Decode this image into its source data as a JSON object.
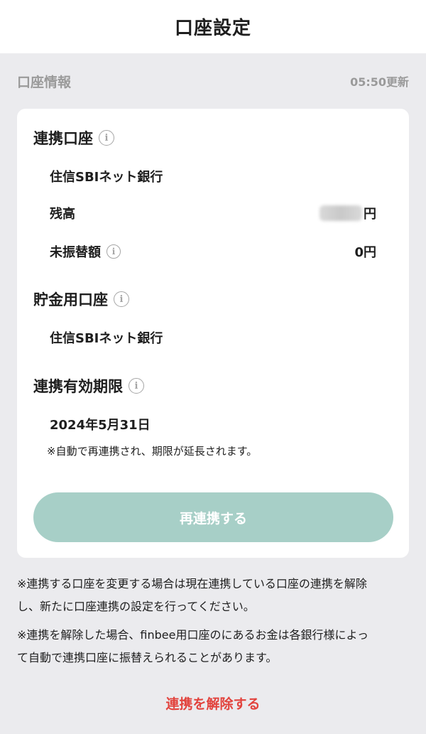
{
  "header": {
    "title": "口座設定"
  },
  "section": {
    "title": "口座情報",
    "updated": "05:50更新"
  },
  "card": {
    "linked_account": {
      "heading": "連携口座",
      "bank": "住信SBIネット銀行",
      "balance_label": "残高",
      "balance_unit": "円",
      "pending_label": "未振替額",
      "pending_value": "0円"
    },
    "savings_account": {
      "heading": "貯金用口座",
      "bank": "住信SBIネット銀行"
    },
    "expiry": {
      "heading": "連携有効期限",
      "date": "2024年5月31日",
      "note": "※自動で再連携され、期限が延長されます。"
    },
    "relink_button": "再連携する"
  },
  "footnotes": {
    "note1_line1": "※連携する口座を変更する場合は現在連携している口座の連携を解除",
    "note1_line2": "し、新たに口座連携の設定を行ってください。",
    "note2_line1": "※連携を解除した場合、finbee用口座のにあるお金は各銀行様によっ",
    "note2_line2": "て自動で連携口座に振替えられることがあります。"
  },
  "unlink_link": "連携を解除する",
  "colors": {
    "accent_button": "#a7cfc7",
    "danger": "#e2433d",
    "background": "#ebebee"
  }
}
